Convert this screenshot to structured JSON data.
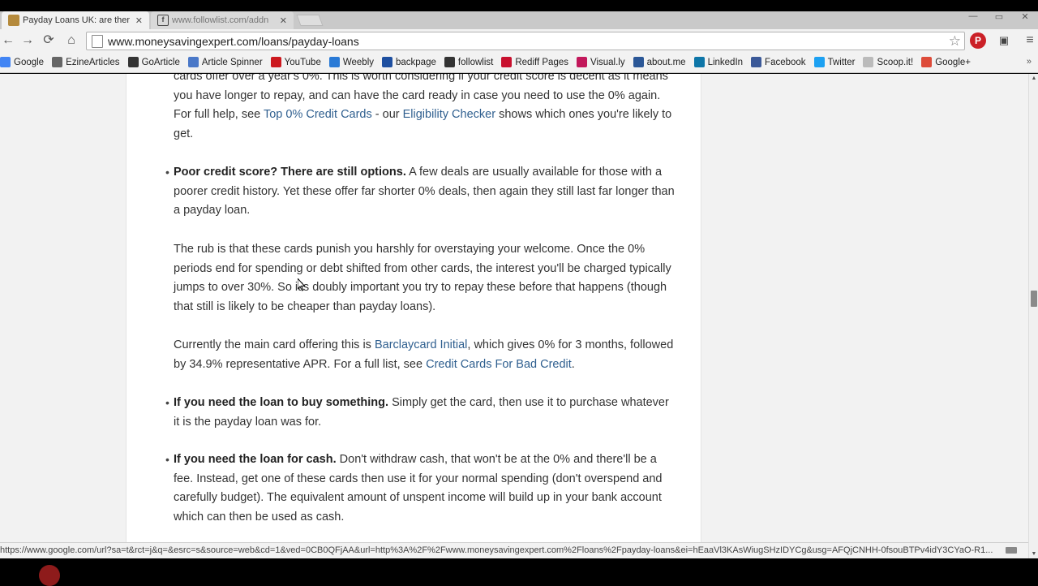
{
  "browser": {
    "tabs": [
      {
        "title": "Payday Loans UK: are ther",
        "close": "✕",
        "active": true
      },
      {
        "title": "www.followlist.com/addn",
        "close": "✕",
        "active": false
      }
    ],
    "window_controls": {
      "minimize": "—",
      "maximize": "▭",
      "close": "✕"
    },
    "url": "www.moneysavingexpert.com/loans/payday-loans",
    "bookmarks": [
      {
        "label": "Google",
        "icon": "google-icon",
        "color": "#4285f4"
      },
      {
        "label": "EzineArticles",
        "icon": "ezine-icon",
        "color": "#666666"
      },
      {
        "label": "GoArticle",
        "icon": "goarticle-icon",
        "color": "#333333"
      },
      {
        "label": "Article Spinner",
        "icon": "spinner-icon",
        "color": "#4a78c8"
      },
      {
        "label": "YouTube",
        "icon": "youtube-icon",
        "color": "#cc181e"
      },
      {
        "label": "Weebly",
        "icon": "weebly-icon",
        "color": "#2a7ad6"
      },
      {
        "label": "backpage",
        "icon": "backpage-icon",
        "color": "#1e4fa0"
      },
      {
        "label": "followlist",
        "icon": "followlist-icon",
        "color": "#333333"
      },
      {
        "label": "Rediff Pages",
        "icon": "rediff-icon",
        "color": "#c8102e"
      },
      {
        "label": "Visual.ly",
        "icon": "visually-icon",
        "color": "#c2185b"
      },
      {
        "label": "about.me",
        "icon": "aboutme-icon",
        "color": "#2b5797"
      },
      {
        "label": "LinkedIn",
        "icon": "linkedin-icon",
        "color": "#0e76a8"
      },
      {
        "label": "Facebook",
        "icon": "facebook-icon",
        "color": "#3b5998"
      },
      {
        "label": "Twitter",
        "icon": "twitter-icon",
        "color": "#1da1f2"
      },
      {
        "label": "Scoop.it!",
        "icon": "page-icon",
        "color": "#bbbbbb"
      },
      {
        "label": "Google+",
        "icon": "googleplus-icon",
        "color": "#dd4b39"
      }
    ],
    "bookmarks_more": "»",
    "status_url": "https://www.google.com/url?sa=t&rct=j&q=&esrc=s&source=web&cd=1&ved=0CB0QFjAA&url=http%3A%2F%2Fwww.moneysavingexpert.com%2Floans%2Fpayday-loans&ei=hEaaVl3KAsWiugSHzIDYCg&usg=AFQjCNHH-0fsouBTPv4idY3CYaO-R1..."
  },
  "article": {
    "para1": {
      "line_a": "cards offer over a year's 0%. This is worth considering if your credit score is decent as it means you have longer to repay, and can have the card ready in case you need to use the 0% again. For full help, see ",
      "link_a": "Top 0% Credit Cards",
      "mid": " - our ",
      "link_b": "Eligibility Checker",
      "end": " shows which ones you're likely to get."
    },
    "bullet1": {
      "bold": "Poor credit score? There are still options.",
      "text": " A few deals are usually available for those with a poorer credit history. Yet these offer far shorter 0% deals, then again they still last far longer than a payday loan."
    },
    "para2": "The rub is that these cards punish you harshly for overstaying your welcome. Once the 0% periods end for spending or debt shifted from other cards, the interest you'll be charged typically jumps to over 30%. So it's doubly important you try to repay these before that happens (though that still is likely to be cheaper than payday loans).",
    "para3": {
      "start": "Currently the main card offering this is ",
      "link_a": "Barclaycard Initial",
      "mid": ", which gives 0% for 3 months, followed by 34.9% representative APR. For a full list, see ",
      "link_b": "Credit Cards For Bad Credit",
      "end": "."
    },
    "bullet2": {
      "bold": "If you need the loan to buy something.",
      "text": " Simply get the card, then use it to purchase whatever it is the payday loan was for."
    },
    "bullet3": {
      "bold": "If you need the loan for cash.",
      "text": " Don't withdraw cash, that won't be at the 0% and there'll be a fee. Instead, get one of these cards then use it for your normal spending (don't overspend and carefully budget). The equivalent amount of unspent income will build up in your bank account which can then be used as cash."
    }
  },
  "icons": {
    "back": "←",
    "forward": "→",
    "reload": "⟳",
    "home": "⌂",
    "star": "☆",
    "pinterest": "P",
    "tool": "▣",
    "menu": "≡",
    "bullet": "•",
    "scroll_up": "▲",
    "scroll_down": "▼"
  },
  "colors": {
    "link": "#2f5f8f",
    "pinterest": "#cb2027"
  }
}
